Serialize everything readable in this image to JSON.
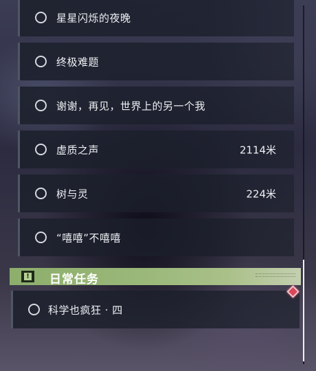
{
  "quests": [
    {
      "name": "星星闪烁的夜晚",
      "distance": ""
    },
    {
      "name": "终极难题",
      "distance": ""
    },
    {
      "name": "谢谢，再见，世界上的另一个我",
      "distance": ""
    },
    {
      "name": "虚质之声",
      "distance": "2114米"
    },
    {
      "name": "树与灵",
      "distance": "224米"
    },
    {
      "name": "“嘻嘻”不嘻嘻",
      "distance": ""
    }
  ],
  "daily_category": {
    "title": "日常任务",
    "icon": "exclamation-icon",
    "accent_color": "#9ab879"
  },
  "daily_quests": [
    {
      "name": "科学也疯狂 · 四"
    }
  ],
  "colors": {
    "marker": "#d9475b",
    "quest_bg": "#1c202c"
  }
}
